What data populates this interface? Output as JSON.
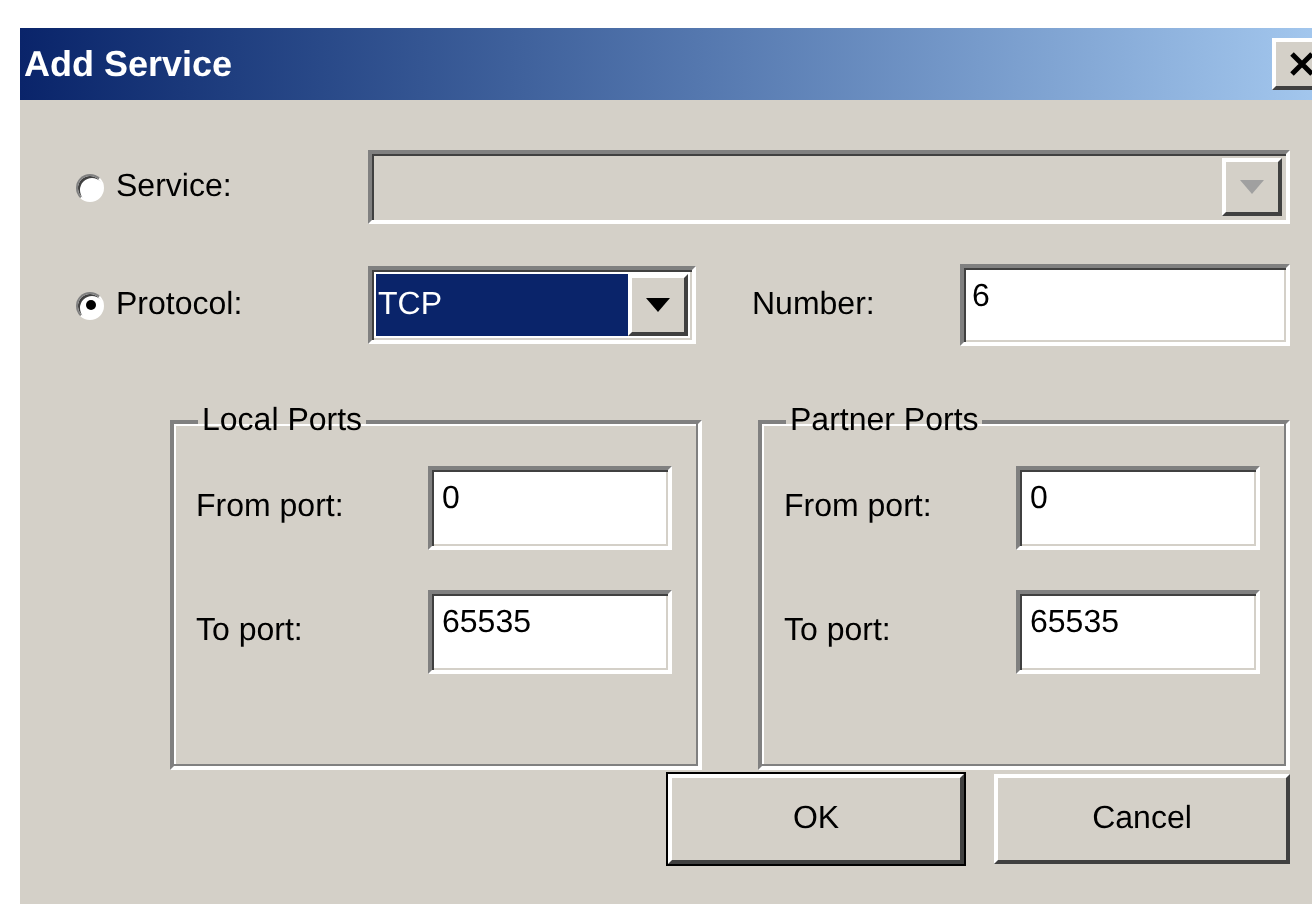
{
  "window": {
    "title": "Add Service"
  },
  "choices": [
    {
      "kind": "dropdown",
      "label": "Service:",
      "selected": false,
      "disabled": true
    },
    {
      "kind": "dropdown",
      "label": "Protocol:",
      "selected": true,
      "disabled": false,
      "value": "TCP"
    }
  ],
  "number": {
    "label": "Number:",
    "value": "6"
  },
  "groups": [
    {
      "title": "Local Ports",
      "from_label": "From port:",
      "from_value": "0",
      "to_label": "To port:",
      "to_value": "65535"
    },
    {
      "title": "Partner Ports",
      "from_label": "From port:",
      "from_value": "0",
      "to_label": "To port:",
      "to_value": "65535"
    }
  ],
  "buttons": [
    {
      "label": "OK",
      "default": true
    },
    {
      "label": "Cancel",
      "default": false
    }
  ]
}
